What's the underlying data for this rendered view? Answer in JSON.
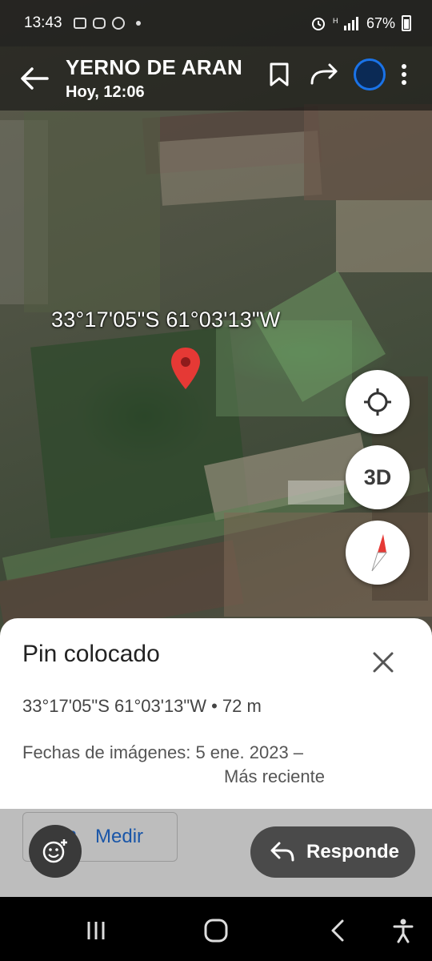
{
  "status_bar": {
    "time": "13:43",
    "battery": "67%",
    "icons": [
      "gallery-icon",
      "youtube-icon",
      "chrome-icon",
      "dot-icon",
      "alarm-icon",
      "signal-icon"
    ]
  },
  "app_bar": {
    "title": "YERNO DE ARAN",
    "subtitle": "Hoy, 12:06"
  },
  "map": {
    "coordinate_label": "33°17'05\"S 61°03'13\"W",
    "buttons": {
      "three_d": "3D"
    }
  },
  "sheet": {
    "title": "Pin colocado",
    "coords": "33°17'05\"S 61°03'13\"W • 72 m",
    "dates_prefix": "Fechas de imágenes: 5 ene. 2023 –",
    "dates_recent": "Más reciente"
  },
  "actions": {
    "medir": "Medir",
    "reply": "Responde"
  },
  "colors": {
    "pin": "#e53935",
    "accent": "#1a73e8",
    "medir_text": "#1a56a8"
  }
}
